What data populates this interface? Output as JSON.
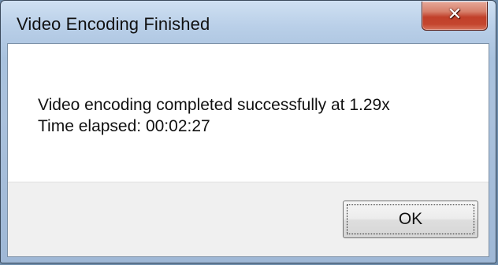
{
  "window": {
    "title": "Video Encoding Finished",
    "close_icon": "close-icon",
    "close_glyph": "✕"
  },
  "message": {
    "line1": "Video encoding completed successfully at 1.29x",
    "line2": "Time elapsed: 00:02:27"
  },
  "buttons": {
    "ok_label": "OK"
  },
  "colors": {
    "close_button_red": "#c1402a",
    "titlebar_blue": "#aac1dc",
    "button_area_gray": "#f0f0f0"
  }
}
